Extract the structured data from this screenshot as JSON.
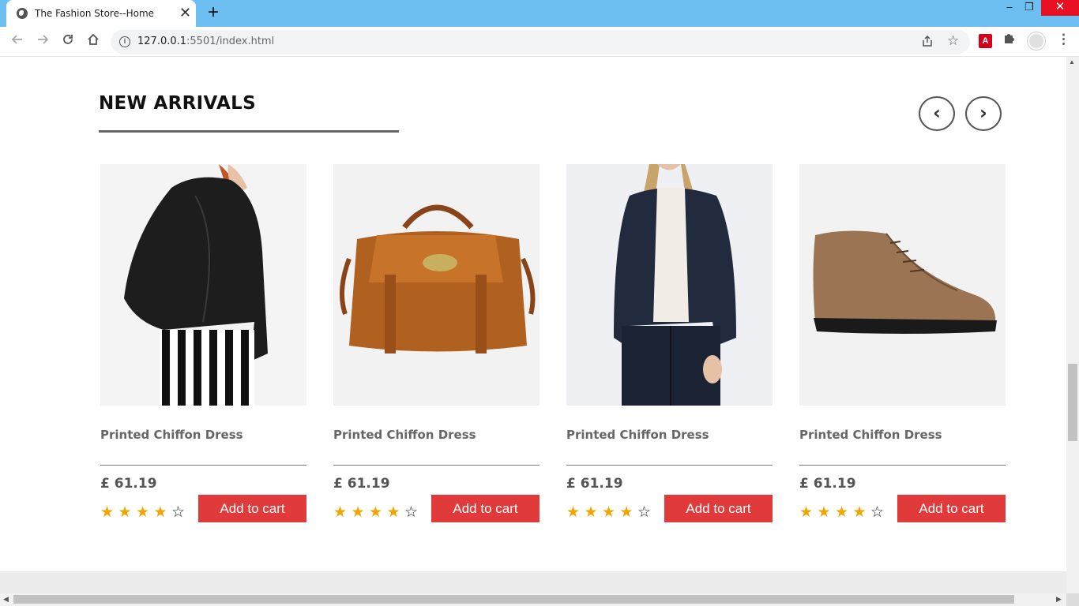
{
  "browser": {
    "tab_title": "The Fashion Store--Home",
    "new_tab_glyph": "+",
    "close_glyph": "✕",
    "url_host": "127.0.0.1",
    "url_rest": ":5501/index.html",
    "window": {
      "minimize": "–",
      "maximize": "❐",
      "close": "✕"
    },
    "icons": [
      "back-icon",
      "forward-icon",
      "reload-icon",
      "home-icon",
      "info-icon",
      "share-icon",
      "star-icon",
      "pdf-extension-icon",
      "puzzle-icon",
      "profile-avatar",
      "menu-icon"
    ]
  },
  "section": {
    "title": "NEW ARRIVALS",
    "prev_glyph": "‹",
    "next_glyph": "›"
  },
  "products": [
    {
      "name": "Printed Chiffon Dress",
      "price": "£ 61.19",
      "rating": 4,
      "rating_max": 5,
      "button": "Add to cart",
      "image": "black leather jacket with striped pants"
    },
    {
      "name": "Printed Chiffon Dress",
      "price": "£ 61.19",
      "rating": 4,
      "rating_max": 5,
      "button": "Add to cart",
      "image": "brown leather satchel bag"
    },
    {
      "name": "Printed Chiffon Dress",
      "price": "£ 61.19",
      "rating": 4,
      "rating_max": 5,
      "button": "Add to cart",
      "image": "navy quilted jacket with white top"
    },
    {
      "name": "Printed Chiffon Dress",
      "price": "£ 61.19",
      "rating": 4,
      "rating_max": 5,
      "button": "Add to cart",
      "image": "brown leather lace-up boot"
    }
  ],
  "colors": {
    "tabbar": "#6cbff0",
    "button_red": "#e03a3a",
    "star_gold": "#f0a500"
  }
}
